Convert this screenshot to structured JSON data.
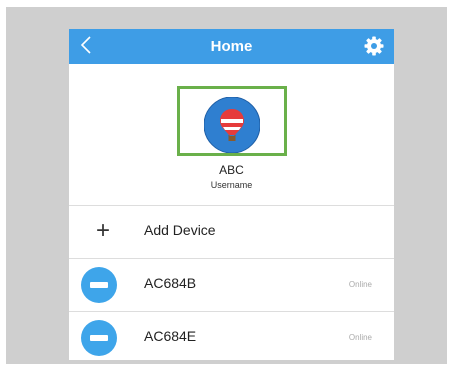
{
  "header": {
    "back_icon": "chevron-left-icon",
    "title": "Home",
    "settings_icon": "gear-icon"
  },
  "profile": {
    "avatar_icon": "hot-air-balloon-icon",
    "name": "ABC",
    "username_label": "Username"
  },
  "add_device": {
    "icon": "plus-icon",
    "label": "Add Device"
  },
  "devices": [
    {
      "name": "AC684B",
      "status": "Online",
      "icon": "air-conditioner-icon"
    },
    {
      "name": "AC684E",
      "status": "Online",
      "icon": "air-conditioner-icon"
    }
  ],
  "colors": {
    "accent": "#3e9de6",
    "device_icon": "#3ea5ea",
    "highlight": "#6ab04a"
  }
}
